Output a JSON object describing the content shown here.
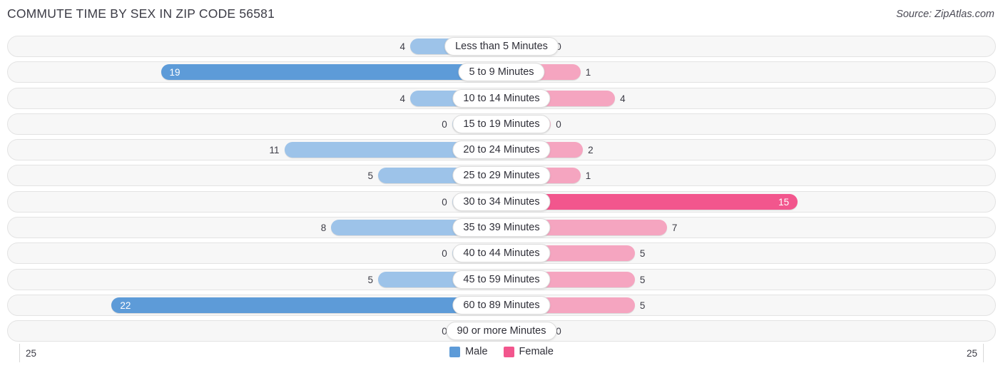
{
  "header": {
    "title": "COMMUTE TIME BY SEX IN ZIP CODE 56581",
    "source": "Source: ZipAtlas.com"
  },
  "axis": {
    "left_max": "25",
    "right_max": "25"
  },
  "legend": {
    "items": [
      {
        "label": "Male",
        "color": "#5d9bd8",
        "swatch": "male-swatch"
      },
      {
        "label": "Female",
        "color": "#f2568d",
        "swatch": "female-swatch"
      }
    ]
  },
  "colors": {
    "male_light": "#9dc3e9",
    "male_strong": "#5d9bd8",
    "female_light": "#f5a5c0",
    "female_strong": "#f2568d",
    "row_background": "#f7f7f7",
    "title_text": "#3c3c46"
  },
  "chart_data": {
    "type": "bar",
    "title": "COMMUTE TIME BY SEX IN ZIP CODE 56581",
    "orientation": "horizontal-diverging",
    "xlabel": "",
    "ylabel": "",
    "xlim": [
      25,
      25
    ],
    "axis_max": 25,
    "grid": false,
    "legend_position": "bottom-center",
    "categories": [
      "Less than 5 Minutes",
      "5 to 9 Minutes",
      "10 to 14 Minutes",
      "15 to 19 Minutes",
      "20 to 24 Minutes",
      "25 to 29 Minutes",
      "30 to 34 Minutes",
      "35 to 39 Minutes",
      "40 to 44 Minutes",
      "45 to 59 Minutes",
      "60 to 89 Minutes",
      "90 or more Minutes"
    ],
    "series": [
      {
        "name": "Male",
        "values": [
          4,
          19,
          4,
          0,
          11,
          5,
          0,
          8,
          0,
          5,
          22,
          0
        ]
      },
      {
        "name": "Female",
        "values": [
          0,
          1,
          4,
          0,
          2,
          1,
          15,
          7,
          5,
          5,
          5,
          0
        ]
      }
    ]
  },
  "rows": [
    {
      "label": "Less than 5 Minutes",
      "male": "4",
      "female": "0",
      "male_w": 18.5,
      "female_w": 10.0,
      "male_hi": false,
      "female_hi": false
    },
    {
      "label": "5 to 9 Minutes",
      "male": "19",
      "female": "1",
      "male_w": 69.0,
      "female_w": 16.0,
      "male_hi": true,
      "female_hi": false
    },
    {
      "label": "10 to 14 Minutes",
      "male": "4",
      "female": "4",
      "male_w": 18.5,
      "female_w": 23.0,
      "male_hi": false,
      "female_hi": false
    },
    {
      "label": "15 to 19 Minutes",
      "male": "0",
      "female": "0",
      "male_w": 10.0,
      "female_w": 10.0,
      "male_hi": false,
      "female_hi": false
    },
    {
      "label": "20 to 24 Minutes",
      "male": "11",
      "female": "2",
      "male_w": 44.0,
      "female_w": 16.5,
      "male_hi": false,
      "female_hi": false
    },
    {
      "label": "25 to 29 Minutes",
      "male": "5",
      "female": "1",
      "male_w": 25.0,
      "female_w": 16.0,
      "male_hi": false,
      "female_hi": false
    },
    {
      "label": "30 to 34 Minutes",
      "male": "0",
      "female": "15",
      "male_w": 10.0,
      "female_w": 60.0,
      "male_hi": false,
      "female_hi": true
    },
    {
      "label": "35 to 39 Minutes",
      "male": "8",
      "female": "7",
      "male_w": 34.5,
      "female_w": 33.5,
      "male_hi": false,
      "female_hi": false
    },
    {
      "label": "40 to 44 Minutes",
      "male": "0",
      "female": "5",
      "male_w": 10.0,
      "female_w": 27.0,
      "male_hi": false,
      "female_hi": false
    },
    {
      "label": "45 to 59 Minutes",
      "male": "5",
      "female": "5",
      "male_w": 25.0,
      "female_w": 27.0,
      "male_hi": false,
      "female_hi": false
    },
    {
      "label": "60 to 89 Minutes",
      "male": "22",
      "female": "5",
      "male_w": 79.0,
      "female_w": 27.0,
      "male_hi": true,
      "female_hi": false
    },
    {
      "label": "90 or more Minutes",
      "male": "0",
      "female": "0",
      "male_w": 10.0,
      "female_w": 10.0,
      "male_hi": false,
      "female_hi": false
    }
  ]
}
